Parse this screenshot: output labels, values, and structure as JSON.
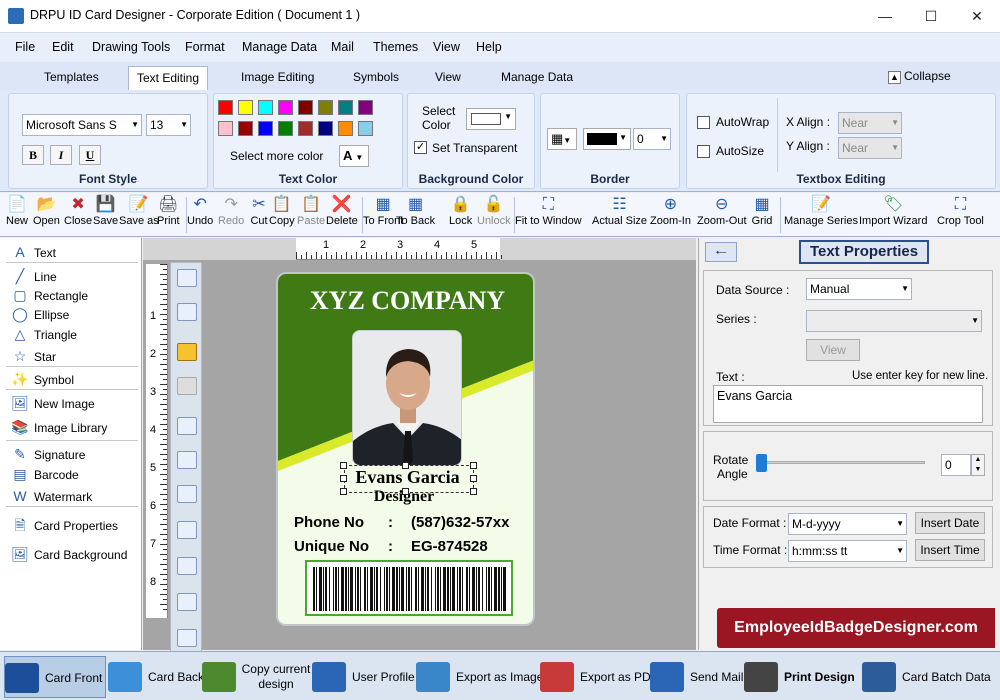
{
  "window": {
    "title": "DRPU ID Card Designer - Corporate Edition ( Document 1 )"
  },
  "menu": [
    "File",
    "Edit",
    "Drawing Tools",
    "Format",
    "Manage Data",
    "Mail",
    "Themes",
    "View",
    "Help"
  ],
  "ribbon_tabs": [
    "Templates",
    "Text Editing",
    "Image Editing",
    "Symbols",
    "View",
    "Manage Data"
  ],
  "collapse_label": "Collapse",
  "font_style": {
    "font": "Microsoft Sans S",
    "size": "13",
    "bold": "B",
    "italic": "I",
    "underline": "U",
    "label": "Font Style"
  },
  "text_color": {
    "swatches": [
      "#ff0000",
      "#ffff00",
      "#00ffff",
      "#ff00ff",
      "#800000",
      "#808000",
      "#008080",
      "#800080",
      "#ffc0cb",
      "#990000",
      "#0000ff",
      "#008000",
      "#a52a2a",
      "#000080",
      "#ff8c00",
      "#87ceeb"
    ],
    "more": "Select more color",
    "font_glyph": "A",
    "label": "Text Color"
  },
  "background_color": {
    "select": "Select",
    "color": "Color",
    "transparent": "Set Transparent",
    "label": "Background Color"
  },
  "border": {
    "width": "0",
    "label": "Border"
  },
  "textbox_editing": {
    "autowrap": "AutoWrap",
    "autosize": "AutoSize",
    "xalign": "X Align :",
    "yalign": "Y Align :",
    "xval": "Near",
    "yval": "Near",
    "label": "Textbox Editing"
  },
  "toolbar": [
    "New",
    "Open",
    "Close",
    "Save",
    "Save as",
    "Print",
    "Undo",
    "Redo",
    "Cut",
    "Copy",
    "Paste",
    "Delete",
    "To Front",
    "To Back",
    "Lock",
    "Unlock",
    "Fit to Window",
    "Actual Size",
    "Zoom-In",
    "Zoom-Out",
    "Grid",
    "Manage Series",
    "Import Wizard",
    "Crop Tool"
  ],
  "left_panel": [
    "Text",
    "Line",
    "Rectangle",
    "Ellipse",
    "Triangle",
    "Star",
    "Symbol",
    "New Image",
    "Image Library",
    "Signature",
    "Barcode",
    "Watermark",
    "Card Properties",
    "Card Background"
  ],
  "ruler": {
    "h": [
      "1",
      "2",
      "3",
      "4",
      "5"
    ],
    "v": [
      "1",
      "2",
      "3",
      "4",
      "5",
      "6",
      "7",
      "8"
    ]
  },
  "card": {
    "company": "XYZ COMPANY",
    "name": "Evans Garcia",
    "title": "Designer",
    "phone_label": "Phone No",
    "phone_sep": ":",
    "phone": "(587)632-57xx",
    "unique_label": "Unique No",
    "unique_sep": ":",
    "unique": "EG-874528",
    "colors": {
      "green": "#3f7a14",
      "lime": "#d8ea2a",
      "bg": "#f3fbe9"
    }
  },
  "text_properties": {
    "title": "Text Properties",
    "data_source_label": "Data Source :",
    "data_source": "Manual",
    "series_label": "Series :",
    "view": "View",
    "text_label": "Text :",
    "hint": "Use enter key for new line.",
    "text_value": "Evans Garcia",
    "rotate_label": "Rotate",
    "angle_label": "Angle",
    "rotate_value": "0",
    "date_format_label": "Date Format :",
    "date_format": "M-d-yyyy",
    "insert_date": "Insert Date",
    "time_format_label": "Time Format :",
    "time_format": "h:mm:ss tt",
    "insert_time": "Insert Time",
    "banner": "EmployeeIdBadgeDesigner.com"
  },
  "bottom": [
    "Card Front",
    "Card Back",
    "Copy current design",
    "User Profile",
    "Export as Image",
    "Export as PDF",
    "Send Mail",
    "Print Design",
    "Card Batch Data"
  ]
}
